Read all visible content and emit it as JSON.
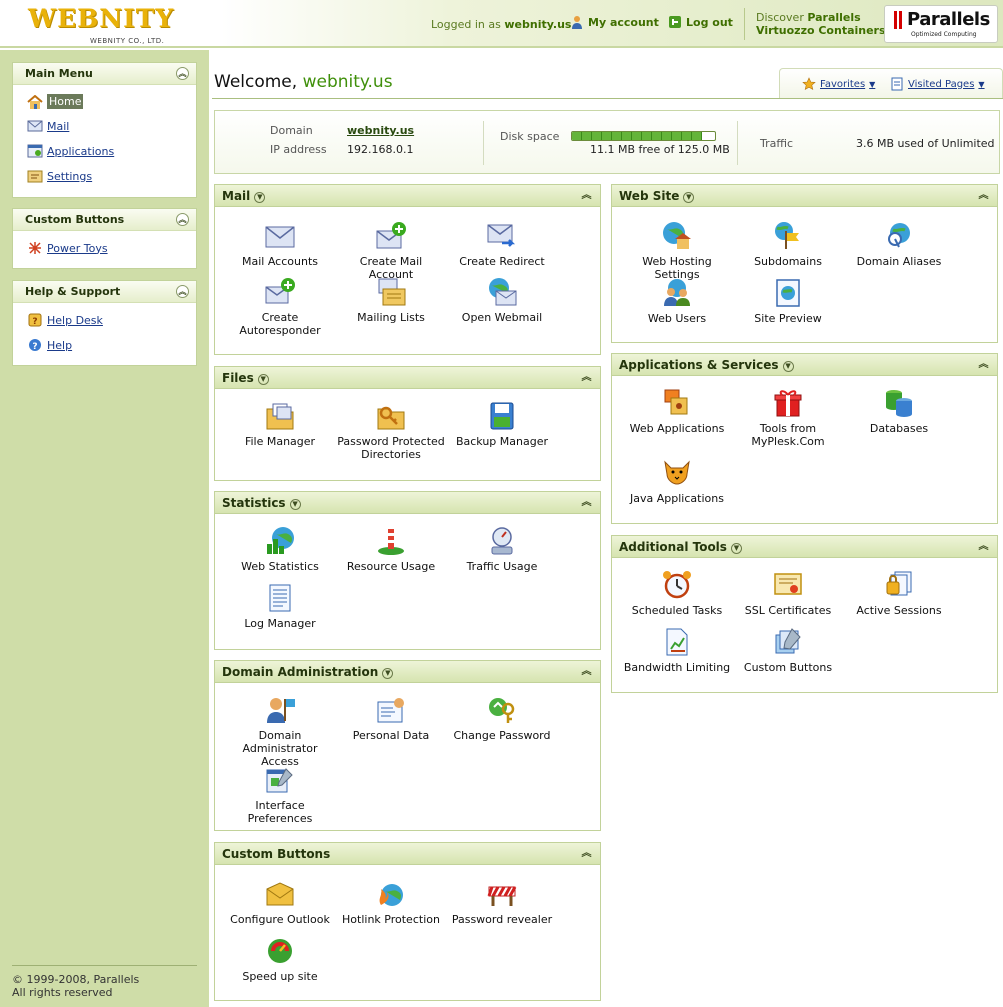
{
  "header": {
    "brand": "WEBNITY",
    "brand_sub": "WEBNITY CO., LTD.",
    "logged_in_prefix": "Logged in as",
    "logged_in_user": "webnity.us",
    "my_account": "My account",
    "log_out": "Log out",
    "discover_prefix": "Discover",
    "discover_brand": "Parallels",
    "discover_product": "Virtuozzo Containers",
    "parallels_logo": "Parallels",
    "parallels_tagline": "Optimized Computing"
  },
  "sidebar": {
    "main_menu": {
      "title": "Main Menu",
      "items": [
        {
          "label": "Home",
          "icon": "home-icon"
        },
        {
          "label": "Mail",
          "icon": "mail-icon"
        },
        {
          "label": "Applications",
          "icon": "applications-icon"
        },
        {
          "label": "Settings",
          "icon": "settings-icon"
        }
      ]
    },
    "custom_buttons": {
      "title": "Custom Buttons",
      "items": [
        {
          "label": "Power Toys",
          "icon": "power-toys-icon"
        }
      ]
    },
    "help_support": {
      "title": "Help & Support",
      "items": [
        {
          "label": "Help Desk",
          "icon": "help-desk-icon"
        },
        {
          "label": "Help",
          "icon": "help-icon"
        }
      ]
    },
    "copyright_1": "© 1999-2008, Parallels",
    "copyright_2": "All rights reserved"
  },
  "main": {
    "welcome_prefix": "Welcome,",
    "welcome_domain": "webnity.us",
    "favorites": "Favorites",
    "visited_pages": "Visited Pages",
    "info": {
      "domain_label": "Domain",
      "domain_value": "webnity.us",
      "ip_label": "IP address",
      "ip_value": "192.168.0.1",
      "disk_label": "Disk space",
      "disk_value": "11.1 MB free of 125.0 MB",
      "disk_used_fraction": 0.91,
      "traffic_label": "Traffic",
      "traffic_value": "3.6 MB used of Unlimited"
    },
    "panels": {
      "mail": {
        "title": "Mail",
        "items": [
          "Mail Accounts",
          "Create Mail Account",
          "Create Redirect",
          "Create Autoresponder",
          "Mailing Lists",
          "Open Webmail"
        ]
      },
      "files": {
        "title": "Files",
        "items": [
          "File Manager",
          "Password Protected Directories",
          "Backup Manager"
        ]
      },
      "statistics": {
        "title": "Statistics",
        "items": [
          "Web Statistics",
          "Resource Usage",
          "Traffic Usage",
          "Log Manager"
        ]
      },
      "domain_admin": {
        "title": "Domain Administration",
        "items": [
          "Domain Administrator Access",
          "Personal Data",
          "Change Password",
          "Interface Preferences"
        ]
      },
      "custom_buttons": {
        "title": "Custom Buttons",
        "items": [
          "Configure Outlook",
          "Hotlink Protection",
          "Password revealer",
          "Speed up site"
        ]
      },
      "web_site": {
        "title": "Web Site",
        "items": [
          "Web Hosting Settings",
          "Subdomains",
          "Domain Aliases",
          "Web Users",
          "Site Preview"
        ]
      },
      "apps_services": {
        "title": "Applications & Services",
        "items": [
          "Web Applications",
          "Tools from MyPlesk.Com",
          "Databases",
          "Java Applications"
        ]
      },
      "additional_tools": {
        "title": "Additional Tools",
        "items": [
          "Scheduled Tasks",
          "SSL Certificates",
          "Active Sessions",
          "Bandwidth Limiting",
          "Custom Buttons"
        ]
      }
    }
  }
}
